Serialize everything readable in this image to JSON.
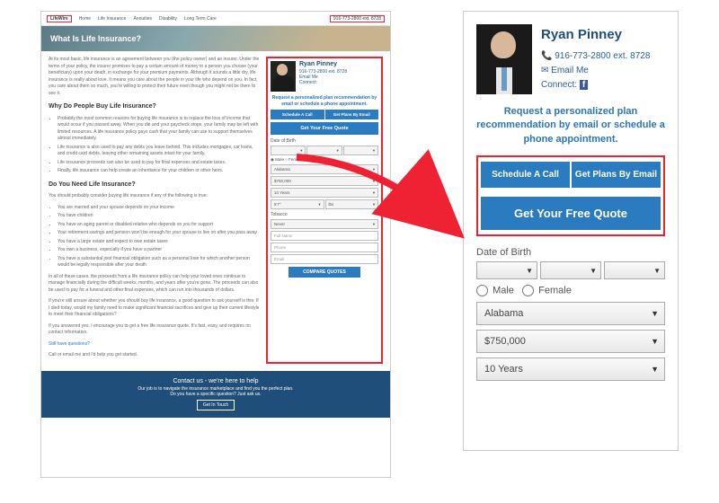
{
  "nav": {
    "logo": "LifeWire",
    "items": [
      "Home",
      "Life Insurance",
      "Annuities",
      "Disability",
      "Long Term Care"
    ],
    "phone": "916-773-2800 ext. 8728"
  },
  "hero_title": "What Is Life Insurance?",
  "article": {
    "intro": "At its most basic, life insurance is an agreement between you (the policy owner) and an insurer. Under the terms of your policy, the insurer promises to pay a certain amount of money to a person you choose (your beneficiary) upon your death, in exchange for your premium payments. Although it sounds a little dry, life insurance is really about love. It means you care about the people in your life who depend on you. In fact, you care about them so much, you're willing to protect their future even though you might not be there to see it.",
    "h2a": "Why Do People Buy Life Insurance?",
    "reasons": [
      "Probably the most common reasons for buying life insurance is to replace the loss of income that would occur if you passed away. When you die and your paycheck stops, your family may be left with limited resources. A life insurance policy pays cash that your family can use to support themselves almost immediately.",
      "Life insurance is also used to pay any debts you leave behind. This includes mortgages, car loans, and credit card debts, leaving other remaining assets intact for your family.",
      "Life insurance proceeds can also be used to pay for final expenses and estate taxes.",
      "Finally, life insurance can help create an inheritance for your children or other heirs."
    ],
    "h2b": "Do You Need Life Insurance?",
    "need_lead": "You should probably consider buying life insurance if any of the following is true:",
    "needs": [
      "You are married and your spouse depends on your income",
      "You have children",
      "You have an aging parent or disabled relative who depends on you for support",
      "Your retirement savings and pension won't be enough for your spouse to live on after you pass away",
      "You have a large estate and expect to owe estate taxes",
      "You own a business, especially if you have a partner",
      "You have a substantial joint financial obligation such as a personal loan for which another person would be legally responsible after your death"
    ],
    "p2": "In all of these cases, the proceeds from a life insurance policy can help your loved ones continue to manage financially during the difficult weeks, months, and years after you're gone. The proceeds can also be used to pay for a funeral and other final expenses, which can run into thousands of dollars.",
    "p3": "If you're still unsure about whether you should buy life insurance, a good question to ask yourself is this: If I died today, would my family need to make significant financial sacrifices and give up their current lifestyle to meet their financial obligations?",
    "p4": "If you answered yes, I encourage you to get a free life insurance quote. It's fast, easy, and requires no contact information.",
    "still": "Still have questions?",
    "still_sub": "Call or email me and I'd help you get started."
  },
  "agent": {
    "name": "Ryan Pinney",
    "phone": "916-773-2800 ext. 8728",
    "email": "Email Me",
    "connect": "Connect:"
  },
  "cta": {
    "request": "Request a personalized plan recommendation by email or schedule a phone appointment.",
    "schedule": "Schedule A Call",
    "plans": "Get Plans By Email",
    "quote": "Get Your Free Quote"
  },
  "form": {
    "dob_label": "Date of Birth",
    "gender_male": "Male",
    "gender_female": "Female",
    "state": "Alabama",
    "amount": "$750,000",
    "term": "10 Years",
    "height": "5'7\"",
    "weight_lbl": "lbs",
    "tobacco_lbl": "Tobacco",
    "tobacco": "Never",
    "name_ph": "Full Name",
    "phone_ph": "Phone",
    "email_ph": "Email",
    "compare": "COMPARE QUOTES"
  },
  "footer": {
    "title": "Contact us - we're here to help",
    "sub1": "Our job is to navigate the insurance marketplace and find you the perfect plan.",
    "sub2": "Do you have a specific question? Just ask us.",
    "btn": "Get In Touch"
  }
}
